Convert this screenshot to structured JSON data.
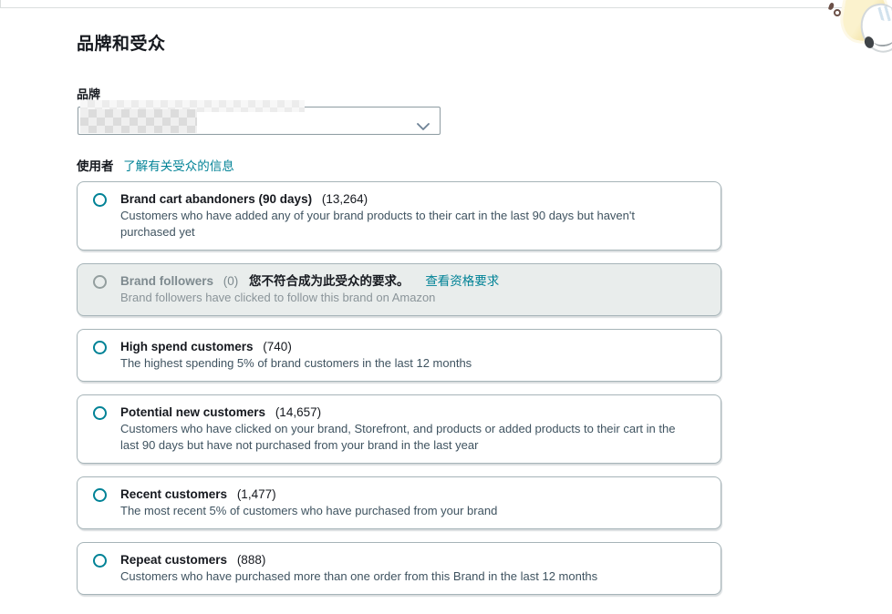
{
  "header": {
    "title": "品牌和受众"
  },
  "brand": {
    "label": "品牌",
    "selected_value_redacted": ""
  },
  "audience_section": {
    "label": "使用者",
    "learn_more_link": "了解有关受众的信息"
  },
  "icons": {
    "select": "chevron-down-icon",
    "sticker": "sticker-decoration"
  },
  "colors": {
    "accent_teal": "#008296",
    "text_dark": "#16191f",
    "text_description": "#3f5360",
    "disabled_bg": "#e9edec",
    "disabled_text": "#7e8a8f",
    "card_border": "#a6b4b8"
  },
  "audiences": [
    {
      "name": "Brand cart abandoners (90 days)",
      "count": "(13,264)",
      "description": "Customers who have added any of your brand products to their cart in the last 90 days but haven't purchased yet",
      "disabled": false,
      "notice": "",
      "notice_link": ""
    },
    {
      "name": "Brand followers",
      "count": "(0)",
      "description": "Brand followers have clicked to follow this brand on Amazon",
      "disabled": true,
      "notice": "您不符合成为此受众的要求。",
      "notice_link": "查看资格要求"
    },
    {
      "name": "High spend customers",
      "count": "(740)",
      "description": "The highest spending 5% of brand customers in the last 12 months",
      "disabled": false,
      "notice": "",
      "notice_link": ""
    },
    {
      "name": "Potential new customers",
      "count": "(14,657)",
      "description": "Customers who have clicked on your brand, Storefront, and products or added products to their cart in the last 90 days but have not purchased from your brand in the last year",
      "disabled": false,
      "notice": "",
      "notice_link": ""
    },
    {
      "name": "Recent customers",
      "count": "(1,477)",
      "description": "The most recent 5% of customers who have purchased from your brand",
      "disabled": false,
      "notice": "",
      "notice_link": ""
    },
    {
      "name": "Repeat customers",
      "count": "(888)",
      "description": "Customers who have purchased more than one order from this Brand in the last 12 months",
      "disabled": false,
      "notice": "",
      "notice_link": ""
    }
  ]
}
